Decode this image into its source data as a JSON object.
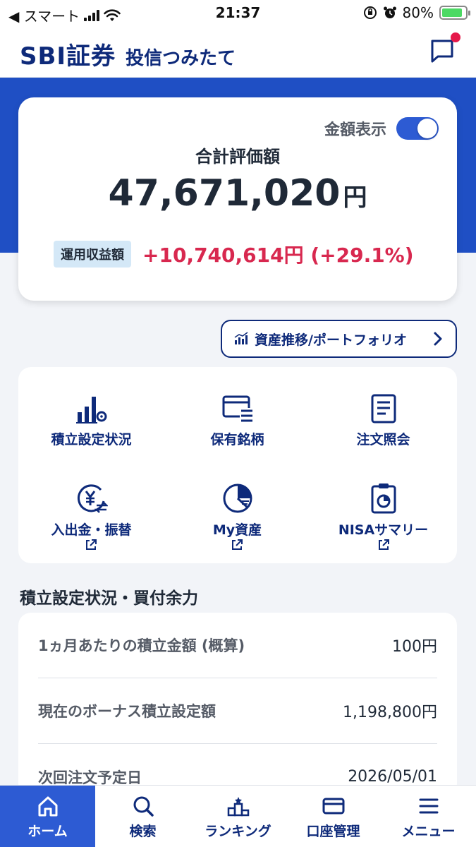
{
  "status_bar": {
    "carrier": "◀ スマート",
    "time": "21:37",
    "battery": "80%"
  },
  "header": {
    "logo": "SBI証券",
    "subtitle": "投信つみたて"
  },
  "summary": {
    "toggle_label": "金額表示",
    "toggle_on": true,
    "total_label": "合計評価額",
    "total_value": "47,671,020",
    "total_unit": "円",
    "gain_badge": "運用収益額",
    "gain_value": "+10,740,614円 (+29.1%)"
  },
  "asset_link": {
    "label": "資産推移/ポートフォリオ"
  },
  "quick_menu": {
    "items": [
      {
        "label": "積立設定状況",
        "icon": "bar-chart-gear-icon"
      },
      {
        "label": "保有銘柄",
        "icon": "card-list-icon"
      },
      {
        "label": "注文照会",
        "icon": "document-icon"
      },
      {
        "label": "入出金・振替",
        "icon": "yen-transfer-icon"
      },
      {
        "label": "My資産",
        "icon": "pie-chart-icon"
      },
      {
        "label": "NISAサマリー",
        "icon": "clipboard-icon"
      }
    ]
  },
  "settings_section": {
    "title": "積立設定状況・買付余力",
    "rows": [
      {
        "label": "1ヵ月あたりの積立金額 (概算)",
        "value": "100円"
      },
      {
        "label": "現在のボーナス積立設定額",
        "value": "1,198,800円"
      },
      {
        "label": "次回注文予定日",
        "value": "2026/05/01"
      }
    ]
  },
  "tabbar": {
    "tabs": [
      {
        "label": "ホーム",
        "active": true
      },
      {
        "label": "検索",
        "active": false
      },
      {
        "label": "ランキング",
        "active": false
      },
      {
        "label": "口座管理",
        "active": false
      },
      {
        "label": "メニュー",
        "active": false
      }
    ]
  },
  "colors": {
    "brand_navy": "#0e2a7a",
    "hero_blue": "#1f4fc4",
    "gain_red": "#d8284f",
    "accent_blue": "#2d5bd3"
  }
}
